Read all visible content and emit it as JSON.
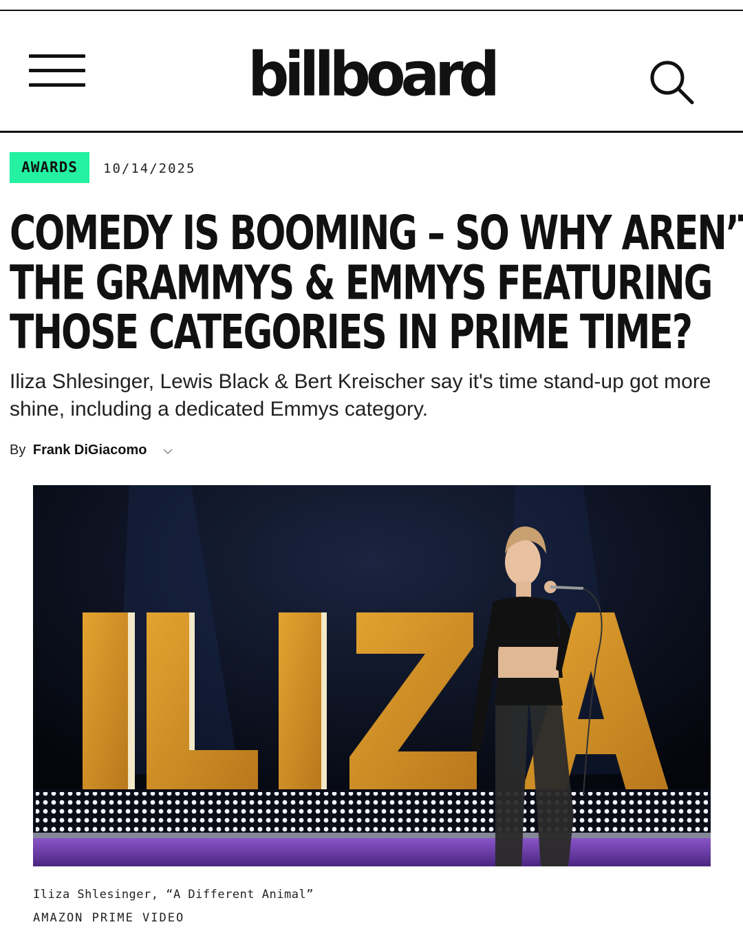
{
  "header": {
    "logo_text": "billboard",
    "menu_icon": "hamburger-menu-icon",
    "search_icon": "search-icon"
  },
  "article": {
    "category_tag": "AWARDS",
    "tag_color": "#24f2a2",
    "date": "10/14/2025",
    "headline_lines": [
      "COMEDY IS BOOMING – SO WHY AREN’T",
      "THE GRAMMYS & EMMYS FEATURING",
      "THOSE CATEGORIES IN PRIME TIME?"
    ],
    "dek": "Iliza Shlesinger, Lewis Black & Bert Kreischer say it's time stand-up got more shine, including a dedicated Emmys category.",
    "byline_prefix": "By",
    "author": "Frank DiGiacomo",
    "author_toggle_icon": "chevron-down-icon"
  },
  "image": {
    "sign_text": "ILIZA",
    "caption": "Iliza Shlesinger, “A Different Animal”",
    "credit": "AMAZON PRIME VIDEO"
  }
}
